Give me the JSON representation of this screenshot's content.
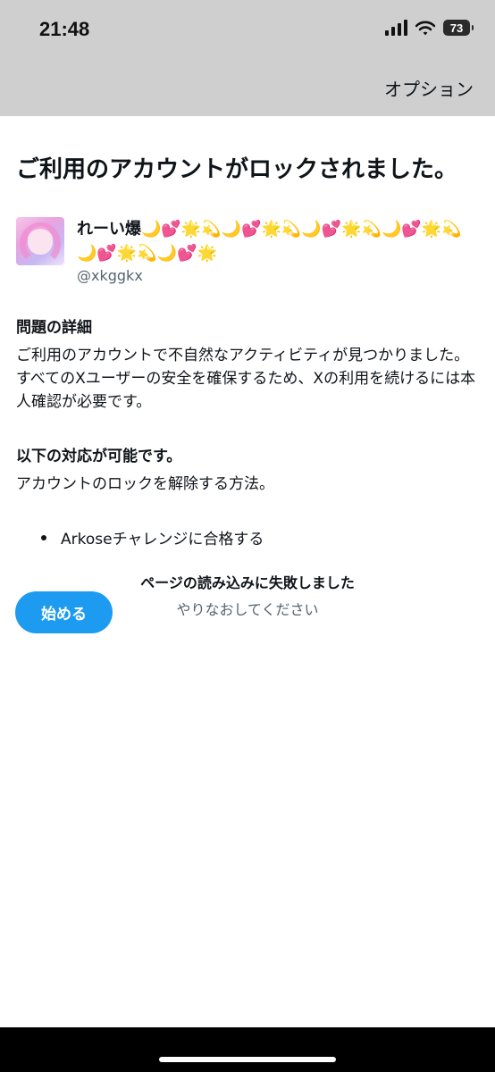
{
  "status_bar": {
    "time": "21:48",
    "battery": "73"
  },
  "header": {
    "options_label": "オプション"
  },
  "main": {
    "title": "ご利用のアカウントがロックされました。",
    "account": {
      "display_name": "れーい爆🌙💕🌟💫🌙💕🌟💫🌙💕🌟💫🌙💕🌟💫🌙💕🌟💫🌙💕🌟",
      "handle": "@xkggkx"
    },
    "details": {
      "heading": "問題の詳細",
      "body": "ご利用のアカウントで不自然なアクティビティが見つかりました。すべてのXユーザーの安全を確保するため、Xの利用を続けるには本人確認が必要です。"
    },
    "actions": {
      "heading": "以下の対応が可能です。",
      "body": "アカウントのロックを解除する方法。",
      "options": [
        "Arkoseチャレンジに合格する"
      ]
    },
    "start_button": "始める"
  },
  "error": {
    "title": "ページの読み込みに失敗しました",
    "retry": "やりなおしてください"
  },
  "colors": {
    "accent": "#1d9bf0",
    "header_bg": "#cfcfcf",
    "muted_text": "#536471"
  }
}
